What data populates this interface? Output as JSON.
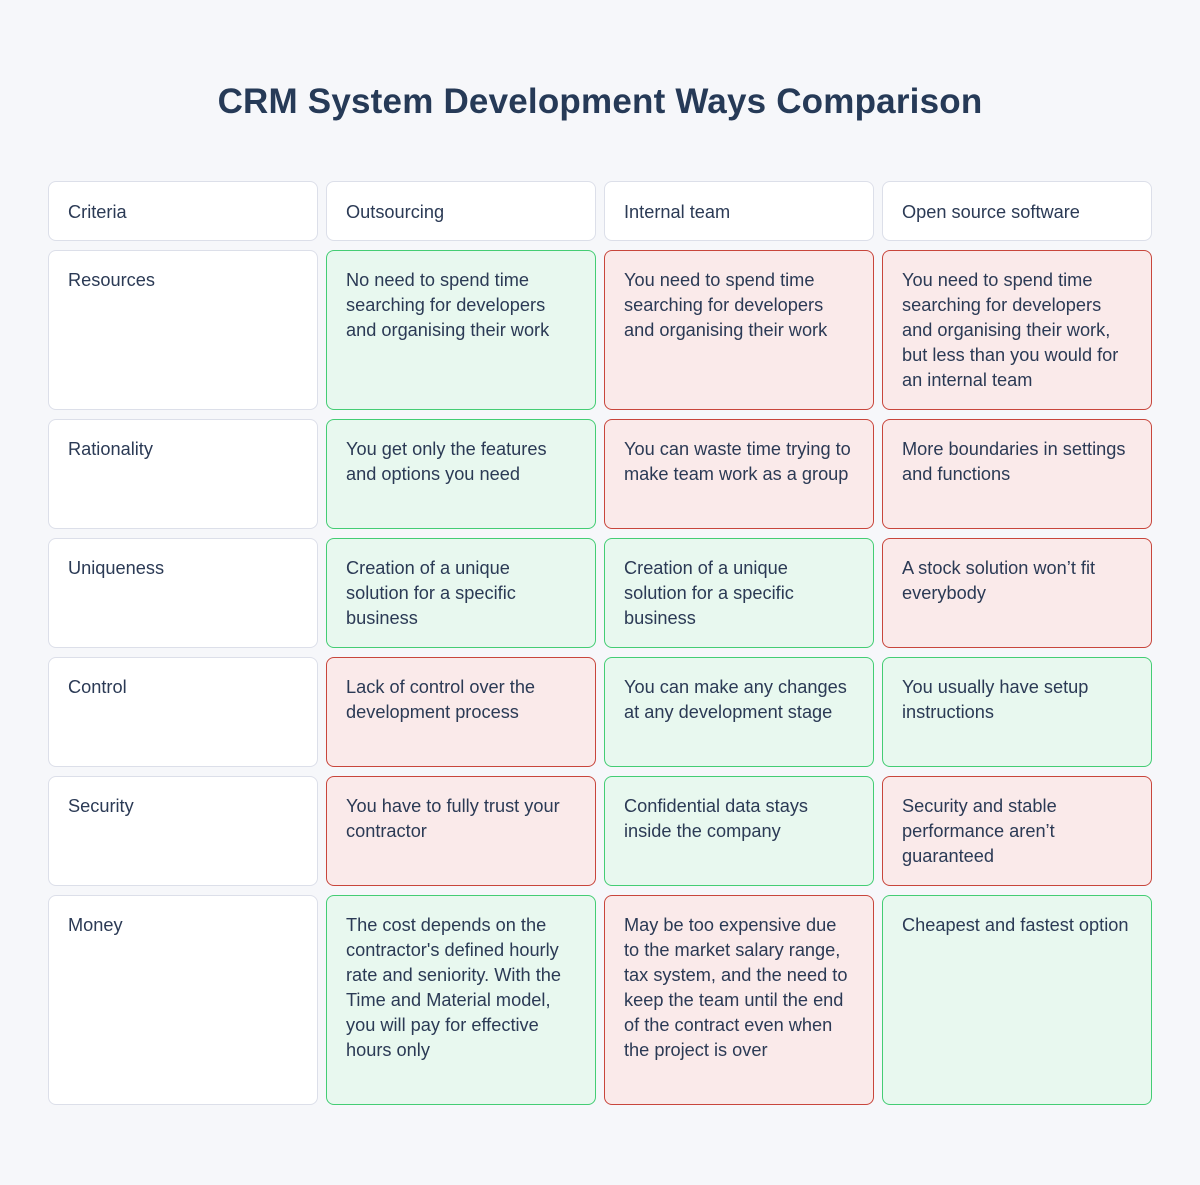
{
  "title": "CRM System Development Ways Comparison",
  "colors": {
    "positive_bg": "#e8f8ef",
    "positive_border": "#44cd74",
    "negative_bg": "#faeaea",
    "negative_border": "#c8463c"
  },
  "headers": [
    "Criteria",
    "Outsourcing",
    "Internal team",
    "Open source software"
  ],
  "rows": [
    {
      "criterion": "Resources",
      "cells": [
        {
          "text": "No need to spend time searching for developers and organising their work",
          "verdict": "positive"
        },
        {
          "text": "You need to spend time searching for developers and organising their work",
          "verdict": "negative"
        },
        {
          "text": "You need to spend time searching for developers and organising their work, but less than you would for an internal team",
          "verdict": "negative"
        }
      ]
    },
    {
      "criterion": "Rationality",
      "cells": [
        {
          "text": "You get only the features and options you need",
          "verdict": "positive"
        },
        {
          "text": "You can waste time trying to make team work as a group",
          "verdict": "negative"
        },
        {
          "text": "More boundaries in settings and functions",
          "verdict": "negative"
        }
      ]
    },
    {
      "criterion": "Uniqueness",
      "cells": [
        {
          "text": "Creation of a unique solution for a specific business",
          "verdict": "positive"
        },
        {
          "text": "Creation of a unique solution for a specific business",
          "verdict": "positive"
        },
        {
          "text": "A stock solution won’t fit everybody",
          "verdict": "negative"
        }
      ]
    },
    {
      "criterion": "Control",
      "cells": [
        {
          "text": "Lack of control over the development process",
          "verdict": "negative"
        },
        {
          "text": "You can make any changes at any development stage",
          "verdict": "positive"
        },
        {
          "text": "You usually have setup instructions",
          "verdict": "positive"
        }
      ]
    },
    {
      "criterion": "Security",
      "cells": [
        {
          "text": "You have to fully trust your contractor",
          "verdict": "negative"
        },
        {
          "text": "Confidential data stays inside the company",
          "verdict": "positive"
        },
        {
          "text": "Security and stable performance aren’t guaranteed",
          "verdict": "negative"
        }
      ]
    },
    {
      "criterion": "Money",
      "cells": [
        {
          "text": "The cost depends on the contractor's defined hourly rate and seniority. With the Time and Material model, you will pay for effective hours only",
          "verdict": "positive"
        },
        {
          "text": "May be too expensive due to the market salary range, tax system, and the need to keep the team until the end of the contract even when the project is over",
          "verdict": "negative"
        },
        {
          "text": "Cheapest and fastest option",
          "verdict": "positive"
        }
      ]
    }
  ]
}
